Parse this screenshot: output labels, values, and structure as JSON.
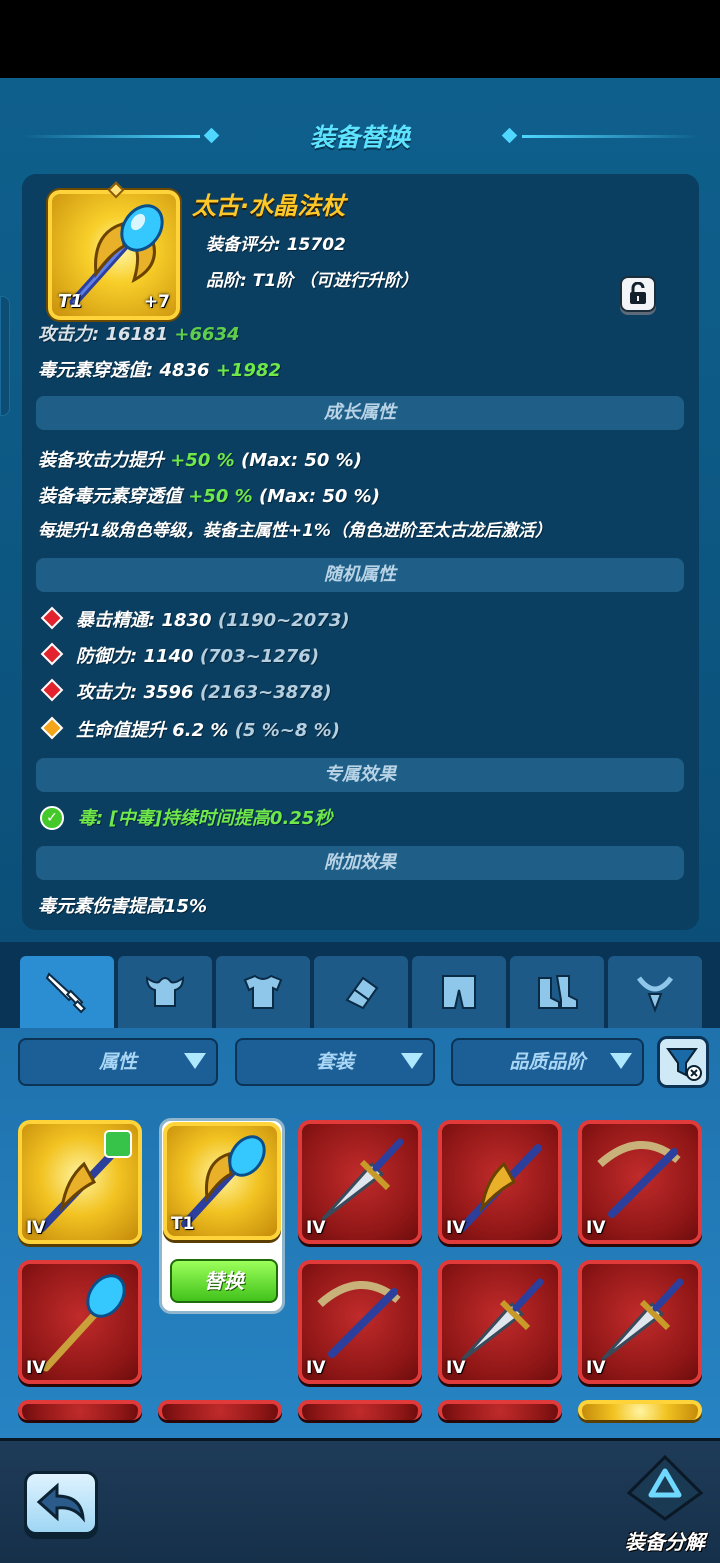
{
  "header": {
    "title": "装备替换"
  },
  "item": {
    "name": "太古·水晶法杖",
    "tier": "T1",
    "enhance": "+7",
    "score_label": "装备评分: 15702",
    "rank_label": "品阶: T1阶 （可进行升阶）"
  },
  "main_stats": [
    {
      "label": "攻击力: 16181",
      "bonus": "+6634"
    },
    {
      "label": "毒元素穿透值: 4836",
      "bonus": "+1982"
    }
  ],
  "sections": {
    "growth": "成长属性",
    "random": "随机属性",
    "exclusive": "专属效果",
    "additional": "附加效果"
  },
  "growth_stats": [
    {
      "label": "装备攻击力提升",
      "bonus": "+50 %",
      "max": "(Max: 50 %)"
    },
    {
      "label": "装备毒元素穿透值",
      "bonus": "+50 %",
      "max": "(Max: 50 %)"
    }
  ],
  "growth_note": "每提升1级角色等级，装备主属性+1%（角色进阶至太古龙后激活）",
  "random_stats": [
    {
      "label": "暴击精通: 1830",
      "range": "(1190~2073)",
      "gem": "red"
    },
    {
      "label": "防御力: 1140",
      "range": "(703~1276)",
      "gem": "red"
    },
    {
      "label": "攻击力: 3596",
      "range": "(2163~3878)",
      "gem": "red"
    },
    {
      "label": "生命值提升 6.2 %",
      "range": "(5 %~8 %)",
      "gem": "gold"
    }
  ],
  "exclusive_effect": "毒: [中毒]持续时间提高0.25秒",
  "additional_effect": "毒元素伤害提高15%",
  "filters": {
    "attribute": "属性",
    "set": "套装",
    "quality": "品质品阶"
  },
  "inventory": {
    "level_label": "IV",
    "tier_label": "T1",
    "replace_label": "替换"
  },
  "footer": {
    "dismantle_label": "装备分解"
  },
  "colors": {
    "accent": "#5ee3ff",
    "gold": "#ffc829",
    "bonus": "#6fe84a",
    "rare": "#e03a3a"
  }
}
